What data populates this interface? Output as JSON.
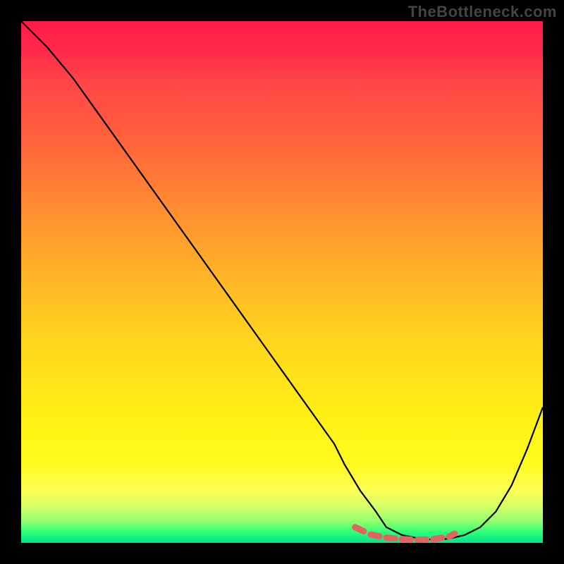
{
  "watermark": "TheBottleneck.com",
  "chart_data": {
    "type": "line",
    "title": "",
    "xlabel": "",
    "ylabel": "",
    "x_range": [
      0,
      100
    ],
    "y_range": [
      0,
      100
    ],
    "gradient_colors": {
      "top": "#ff1a4a",
      "mid": "#ffe518",
      "bottom": "#00e58a"
    },
    "series": [
      {
        "name": "bottleneck-curve",
        "x": [
          0,
          5,
          10,
          15,
          20,
          25,
          30,
          35,
          40,
          45,
          50,
          55,
          60,
          62,
          65,
          68,
          70,
          73,
          76,
          79,
          82,
          85,
          88,
          91,
          94,
          97,
          100
        ],
        "y": [
          100,
          95,
          89,
          82,
          75,
          68,
          61,
          54,
          47,
          40,
          33,
          26,
          19,
          15,
          10,
          6,
          3,
          1.5,
          0.9,
          0.6,
          0.8,
          1.5,
          3,
          6,
          11,
          18,
          26
        ]
      }
    ],
    "optimal_region": {
      "name": "near-minimum-markers",
      "x": [
        64,
        67,
        70,
        73,
        76,
        79,
        82,
        84
      ],
      "y": [
        3.0,
        1.6,
        1.0,
        0.7,
        0.6,
        0.7,
        1.2,
        2.2
      ],
      "marker_color": "#e3635f"
    },
    "annotations": []
  }
}
